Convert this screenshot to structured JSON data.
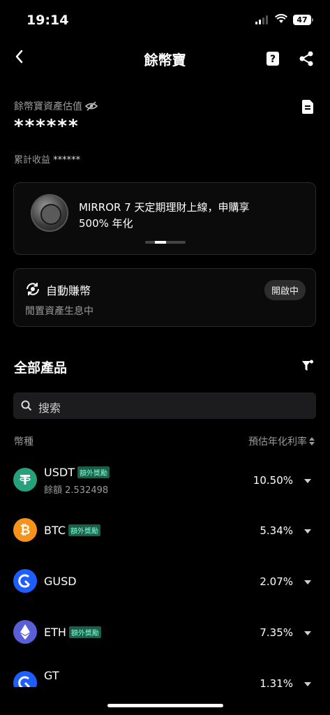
{
  "status": {
    "time": "19:14",
    "battery": "47"
  },
  "nav": {
    "title": "餘幣寶"
  },
  "asset": {
    "label": "餘幣寶資產估值",
    "value": "******",
    "cumulative_label": "累計收益",
    "cumulative_value": "******"
  },
  "banner": {
    "text_line1": "MIRROR 7 天定期理財上線，申購享",
    "text_line2": "500% 年化"
  },
  "auto_earn": {
    "title": "自動賺幣",
    "status": "開啟中",
    "subtitle": "閒置資產生息中"
  },
  "products": {
    "title": "全部產品",
    "search_placeholder": "搜索",
    "col_coin": "幣種",
    "col_rate": "預估年化利率"
  },
  "coins": [
    {
      "symbol": "USDT",
      "badge": "額外獎勵",
      "balance": "餘額 2.532498",
      "rate": "10.50%",
      "color": "#26a17b",
      "icon": "tether-icon"
    },
    {
      "symbol": "BTC",
      "badge": "額外獎勵",
      "balance": "",
      "rate": "5.34%",
      "color": "#f7931a",
      "icon": "bitcoin-icon"
    },
    {
      "symbol": "GUSD",
      "badge": "",
      "balance": "",
      "rate": "2.07%",
      "color": "#1e5eff",
      "icon": "gusd-icon"
    },
    {
      "symbol": "ETH",
      "badge": "額外獎勵",
      "balance": "",
      "rate": "7.35%",
      "color": "#5a5fd8",
      "icon": "ethereum-icon"
    },
    {
      "symbol": "GT",
      "badge": "",
      "balance": "",
      "rate": "1.31%",
      "color": "#1e5eff",
      "icon": "gt-icon"
    }
  ]
}
